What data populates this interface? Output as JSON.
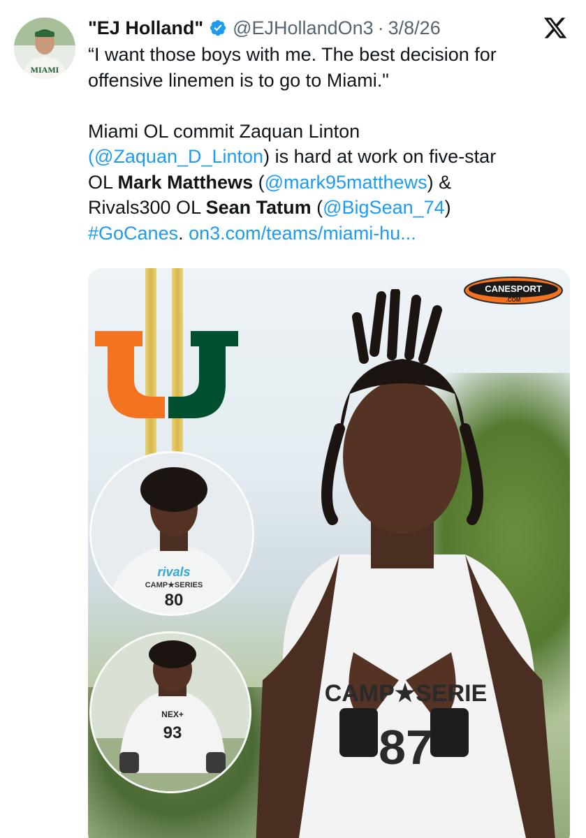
{
  "tweet": {
    "author_name": "\"EJ Holland\"",
    "handle": "@EJHollandOn3",
    "separator": "·",
    "date": "3/8/26",
    "lines": {
      "quote_1": "“I want those boys with me. The best decision for",
      "quote_2": "offensive linemen is to go to Miami.\"",
      "body_1": "Miami OL commit Zaquan Linton",
      "body_2_link": "(@Zaquan_D_Linton",
      "body_2_rest": ") is hard at work on five-star",
      "body_3_pre": "OL ",
      "body_3_bold": "Mark Matthews",
      "body_3_mid": " (",
      "body_3_link": "@mark95matthews",
      "body_3_post": ") &",
      "body_4_pre": "Rivals300 OL ",
      "body_4_bold": "Sean Tatum",
      "body_4_mid": " (",
      "body_4_link": "@BigSean_74",
      "body_4_post": ")",
      "body_5_hashtag": "#GoCanes",
      "body_5_dot": ". ",
      "body_5_url": "on3.com/teams/miami-hu..."
    }
  },
  "avatar": {
    "shirt_text": "MIAMI"
  },
  "media": {
    "brand_badge": "CANESPORT",
    "brand_badge_sub": ".COM",
    "jersey_main": "87",
    "jersey_main_text": "CAMP★SERIE",
    "jersey_c1_brand": "rivals",
    "jersey_c1_text": "CAMP★SERIES",
    "jersey_c1": "80",
    "jersey_c2_text": "NEX+",
    "jersey_c2": "93"
  },
  "colors": {
    "link": "#1d9bf0",
    "text": "#0f1419",
    "muted": "#536471",
    "verified": "#1d9bf0",
    "miami_orange": "#f47321",
    "miami_green": "#005030"
  },
  "icons": [
    "verified-badge-icon",
    "x-logo-icon"
  ]
}
